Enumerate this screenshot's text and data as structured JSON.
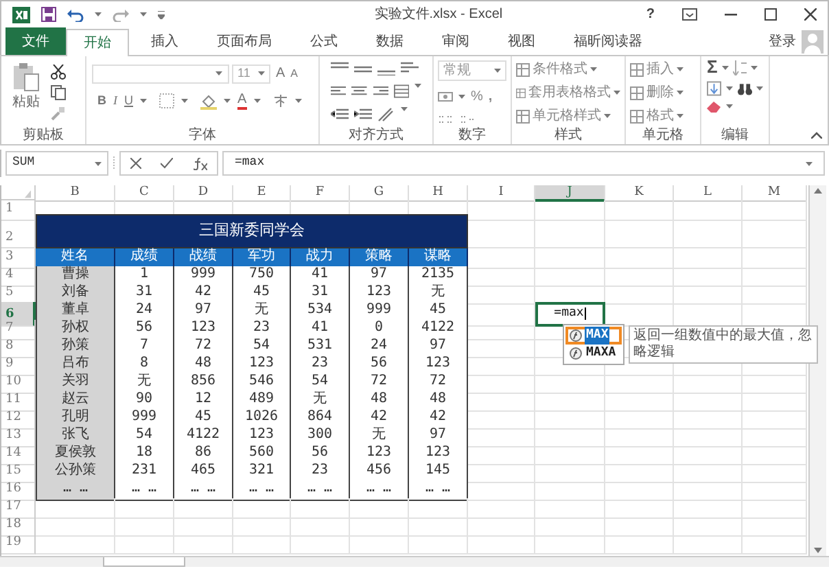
{
  "window": {
    "title": "实验文件.xlsx - Excel",
    "help": "?"
  },
  "ribbon_tabs": [
    {
      "label": "文件",
      "kind": "file",
      "selected": false
    },
    {
      "label": "开始",
      "kind": "tab",
      "selected": true
    },
    {
      "label": "插入",
      "kind": "tab",
      "selected": false
    },
    {
      "label": "页面布局",
      "kind": "tab",
      "selected": false
    },
    {
      "label": "公式",
      "kind": "tab",
      "selected": false
    },
    {
      "label": "数据",
      "kind": "tab",
      "selected": false
    },
    {
      "label": "审阅",
      "kind": "tab",
      "selected": false
    },
    {
      "label": "视图",
      "kind": "tab",
      "selected": false
    },
    {
      "label": "福昕阅读器",
      "kind": "tab",
      "selected": false
    }
  ],
  "account": {
    "label": "登录"
  },
  "ribbon": {
    "clipboard": {
      "paste": "粘贴",
      "label": "剪贴板"
    },
    "font": {
      "size": "11",
      "grow": "A",
      "shrink": "A",
      "bold": "B",
      "italic": "I",
      "underline": "U",
      "font_color_button": "A",
      "label": "字体"
    },
    "alignment": {
      "label": "对齐方式"
    },
    "number": {
      "format": "常规",
      "percent": "%",
      "comma": ",",
      "label": "数字"
    },
    "styles": {
      "items": [
        "条件格式",
        "套用表格格式",
        "单元格样式"
      ],
      "label": "样式"
    },
    "cells": {
      "items": [
        "插入",
        "删除",
        "格式"
      ],
      "label": "单元格"
    },
    "editing": {
      "sum": "Σ",
      "label": "编辑"
    }
  },
  "formula_bar": {
    "name_box": "SUM",
    "formula": "=max"
  },
  "sheet": {
    "columns": [
      {
        "label": "B",
        "selected": false
      },
      {
        "label": "C",
        "selected": false
      },
      {
        "label": "D",
        "selected": false
      },
      {
        "label": "E",
        "selected": false
      },
      {
        "label": "F",
        "selected": false
      },
      {
        "label": "G",
        "selected": false
      },
      {
        "label": "H",
        "selected": false
      },
      {
        "label": "I",
        "selected": false
      },
      {
        "label": "J",
        "selected": true
      },
      {
        "label": "K",
        "selected": false
      },
      {
        "label": "L",
        "selected": false
      },
      {
        "label": "M",
        "selected": false
      }
    ],
    "row_numbers": [
      {
        "label": "1",
        "selected": false
      },
      {
        "label": "2",
        "selected": false
      },
      {
        "label": "3",
        "selected": false
      },
      {
        "label": "4",
        "selected": false
      },
      {
        "label": "5",
        "selected": false
      },
      {
        "label": "6",
        "selected": true
      },
      {
        "label": "7",
        "selected": false
      },
      {
        "label": "8",
        "selected": false
      },
      {
        "label": "9",
        "selected": false
      },
      {
        "label": "10",
        "selected": false
      },
      {
        "label": "11",
        "selected": false
      },
      {
        "label": "12",
        "selected": false
      },
      {
        "label": "13",
        "selected": false
      },
      {
        "label": "14",
        "selected": false
      },
      {
        "label": "15",
        "selected": false
      },
      {
        "label": "16",
        "selected": false
      },
      {
        "label": "17",
        "selected": false
      },
      {
        "label": "18",
        "selected": false
      },
      {
        "label": "19",
        "selected": false
      }
    ],
    "table_title": "三国新委同学会",
    "table_headers": [
      "姓名",
      "成绩",
      "战绩",
      "军功",
      "战力",
      "策略",
      "谋略"
    ],
    "table_rows": [
      [
        "曹操",
        "1",
        "999",
        "750",
        "41",
        "97",
        "2135"
      ],
      [
        "刘备",
        "31",
        "42",
        "45",
        "31",
        "123",
        "无"
      ],
      [
        "董卓",
        "24",
        "97",
        "无",
        "534",
        "999",
        "45"
      ],
      [
        "孙权",
        "56",
        "123",
        "23",
        "41",
        "0",
        "4122"
      ],
      [
        "孙策",
        "7",
        "72",
        "54",
        "531",
        "24",
        "97"
      ],
      [
        "吕布",
        "8",
        "48",
        "123",
        "23",
        "56",
        "123"
      ],
      [
        "关羽",
        "无",
        "856",
        "546",
        "54",
        "72",
        "72"
      ],
      [
        "赵云",
        "90",
        "12",
        "489",
        "无",
        "48",
        "48"
      ],
      [
        "孔明",
        "999",
        "45",
        "1026",
        "864",
        "42",
        "42"
      ],
      [
        "张飞",
        "54",
        "4122",
        "123",
        "300",
        "无",
        "97"
      ],
      [
        "夏侯敦",
        "18",
        "86",
        "560",
        "56",
        "123",
        "123"
      ],
      [
        "公孙策",
        "231",
        "465",
        "321",
        "23",
        "456",
        "145"
      ],
      [
        "… …",
        "… …",
        "… …",
        "… …",
        "… …",
        "… …",
        "… …"
      ]
    ],
    "active_cell": {
      "value": "=max"
    },
    "autocomplete": [
      {
        "label": "MAX",
        "selected": true
      },
      {
        "label": "MAXA",
        "selected": false
      }
    ],
    "tooltip": "返回一组数值中的最大值，忽略逻辑"
  }
}
